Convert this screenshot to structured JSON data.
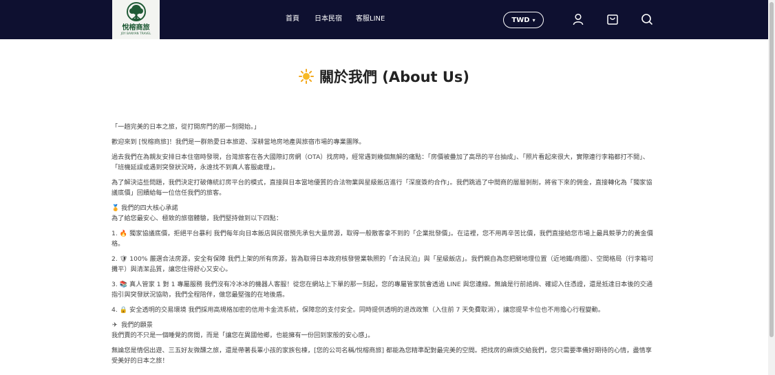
{
  "header": {
    "brand_name": "悅榕商旅",
    "brand_sub": "JOY BANYAN TRAVEL",
    "nav": [
      "首頁",
      "日本民宿",
      "客服LINE"
    ],
    "currency": "TWD",
    "currency_chevron": "▾",
    "icons": [
      "user-icon",
      "bag-icon",
      "search-icon"
    ],
    "colors": {
      "bar": "#0e1030",
      "logo_bg": "#f3f4f1",
      "logo_green": "#1f5a35"
    }
  },
  "title": "關於我們 (About Us)",
  "paragraphs": {
    "p1": "「一趟完美的日本之旅，從打開房門的那一刻開始。」",
    "p2": "歡迎來到 [悅榕商旅]！我們是一群熱愛日本旅遊、深耕當地房地產與旅宿市場的專業團隊。",
    "p3": "過去我們在為親友安排日本住宿時發現，台灣旅客在各大國際訂房網（OTA）找房時，經常遇到幾個無解的痛點：「房價被疊加了高昂的平台抽成」、「照片看起來很大，實際連行李箱都打不開」、「班機延誤或遇到突發狀況時，永遠找不到真人客服處理」。",
    "p4": "為了解決這些問題，我們決定打破傳統訂房平台的模式，直接與日本當地優質的合法物業與星級飯店進行「深度簽約合作」。我們跳過了中間商的層層剝削，將省下來的佣金，直接轉化為「獨家協議底價」回饋給每一位信任我們的旅客。",
    "h1": "我們的四大核心承諾",
    "p5": "為了給您最安心、極致的旅宿體驗，我們堅持做到以下四點：",
    "l1": "1. 🔥 獨家協議底價，拒絕平台暴利 我們每年向日本飯店與民宿預先承包大量房源，取得一般散客拿不到的「企業批發價」。在這裡，您不用再辛苦比價，我們直接給您市場上最具競爭力的黃金價格。",
    "l2": "2. 🛡 100% 嚴選合法房源，安全有保障 我們上架的所有房源，皆為取得日本政府核發營業執照的「合法民泊」與「星級飯店」。我們親自為您把關地理位置（近地鐵/商圈）、空間格局（行李箱可攤平）與清潔品質，讓您住得舒心又安心。",
    "l3": "3. 📚 真人管家 1 對 1 專屬服務 我們沒有冷冰冰的機器人客服！從您在網站上下單的那一刻起，您的專屬管家就會透過 LINE 與您連線。無論是行前諮詢、確認入住憑證，還是抵達日本後的交通指引與突發狀況協助，我們全程陪伴，做您最堅強的在地後盾。",
    "l4": "4. 🔒 安全透明的交易環境 我們採用高規格加密的信用卡金流系統，保障您的支付安全。同時提供透明的退改政策（入住前 7 天免費取消），讓您提早卡位也不用擔心行程變動。",
    "h2": "我們的願景",
    "p6": "我們賣的不只是一個睡覺的房間，而是「讓您在異國他鄉，也能擁有一份回到家般的安心感」。",
    "p7": "無論您是情侶出遊、三五好友微醺之旅，還是帶著長輩小孩的家族包棟，[您的公司名稱/悅榕商旅] 都能為您精準配對最完美的空間。把找房的麻煩交給我們，您只需要準備好期待的心情，盡情享受美好的日本之旅！"
  },
  "heading_icons": {
    "h1": "🏅",
    "h2": "✈"
  }
}
